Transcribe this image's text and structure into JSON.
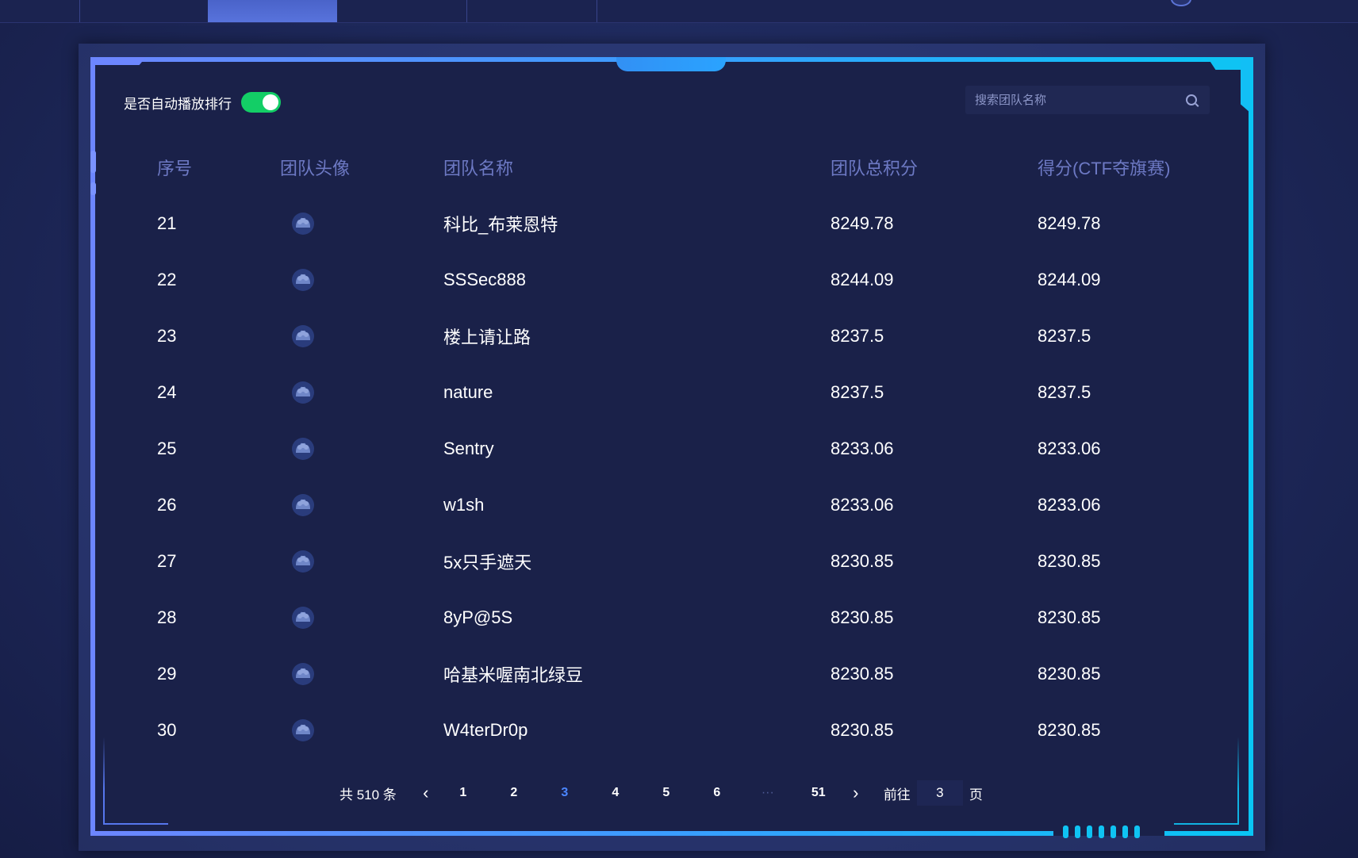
{
  "autoplay": {
    "label": "是否自动播放排行",
    "enabled": true
  },
  "search": {
    "placeholder": "搜索团队名称"
  },
  "table": {
    "headers": {
      "rank": "序号",
      "avatar": "团队头像",
      "name": "团队名称",
      "total": "团队总积分",
      "ctf": "得分(CTF夺旗赛)"
    },
    "rows": [
      {
        "rank": "21",
        "name": "科比_布莱恩特",
        "total": "8249.78",
        "ctf": "8249.78"
      },
      {
        "rank": "22",
        "name": "SSSec888",
        "total": "8244.09",
        "ctf": "8244.09"
      },
      {
        "rank": "23",
        "name": "楼上请让路",
        "total": "8237.5",
        "ctf": "8237.5"
      },
      {
        "rank": "24",
        "name": "nature",
        "total": "8237.5",
        "ctf": "8237.5"
      },
      {
        "rank": "25",
        "name": "Sentry",
        "total": "8233.06",
        "ctf": "8233.06"
      },
      {
        "rank": "26",
        "name": "w1sh",
        "total": "8233.06",
        "ctf": "8233.06"
      },
      {
        "rank": "27",
        "name": "5x只手遮天",
        "total": "8230.85",
        "ctf": "8230.85"
      },
      {
        "rank": "28",
        "name": "8yP@5S",
        "total": "8230.85",
        "ctf": "8230.85"
      },
      {
        "rank": "29",
        "name": "哈基米喔南北绿豆",
        "total": "8230.85",
        "ctf": "8230.85"
      },
      {
        "rank": "30",
        "name": "W4terDr0p",
        "total": "8230.85",
        "ctf": "8230.85"
      }
    ]
  },
  "pagination": {
    "total_text": "共 510 条",
    "prev": "‹",
    "next": "›",
    "pages": [
      "1",
      "2",
      "3",
      "4",
      "5",
      "6"
    ],
    "current": "3",
    "ellipsis": "···",
    "last": "51",
    "goto_prefix": "前往",
    "goto_value": "3",
    "goto_suffix": "页"
  },
  "colors": {
    "accent": "#4b86ff",
    "toggle_on": "#13ce66",
    "panel_bg": "#1a2149",
    "header_text": "#6d79c4",
    "frame_start": "#6c86ff",
    "frame_end": "#09c6f5"
  }
}
